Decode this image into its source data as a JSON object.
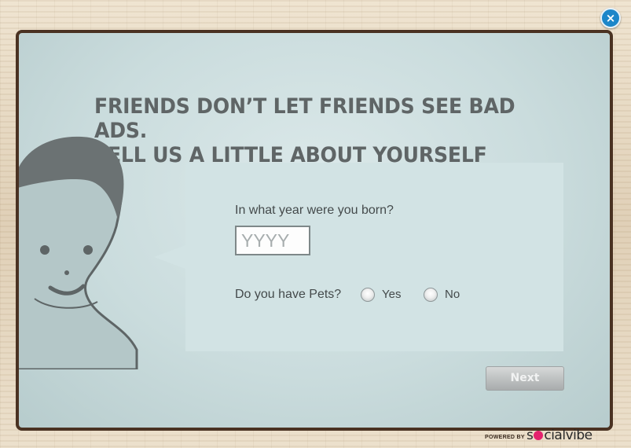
{
  "dialog": {
    "close_label": "×",
    "headline_line1": "FRIENDS DON’T LET FRIENDS SEE BAD ADS.",
    "headline_line2": "TELL US A LITTLE ABOUT YOURSELF"
  },
  "form": {
    "year_question": "In what year were you born?",
    "year_placeholder": "YYYY",
    "year_value": "",
    "pets_question": "Do you have Pets?",
    "pets_options": [
      {
        "label": "Yes",
        "selected": false
      },
      {
        "label": "No",
        "selected": false
      }
    ],
    "next_label": "Next"
  },
  "footer": {
    "powered_by": "POWERED BY",
    "brand_prefix": "s",
    "brand_suffix": "cialvibe"
  },
  "colors": {
    "close_button": "#1c86c9",
    "frame_border": "#4a3222",
    "panel_bg": "#cadcdd",
    "brand_accent": "#e4226d"
  }
}
